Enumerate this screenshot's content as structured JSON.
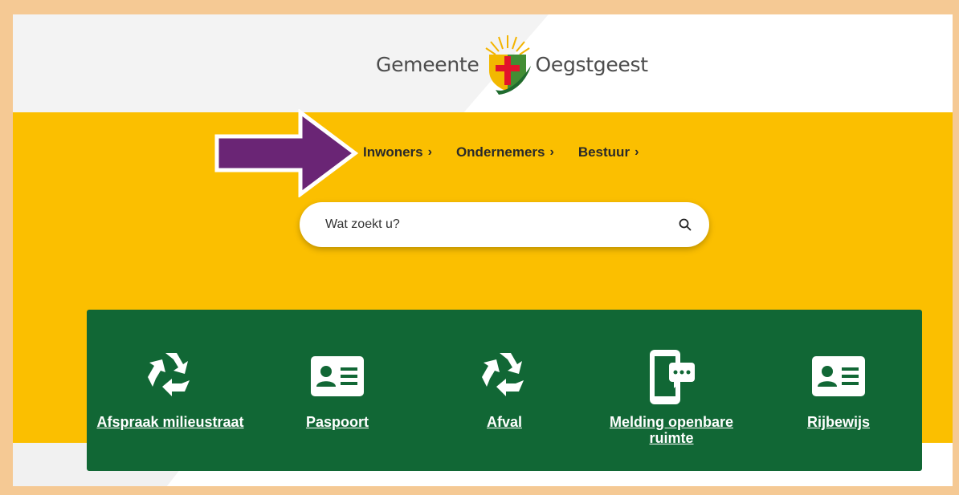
{
  "header": {
    "logo_left": "Gemeente",
    "logo_right": "Oegstgeest"
  },
  "nav": {
    "items": [
      {
        "label": "Inwoners",
        "chevron": "›"
      },
      {
        "label": "Ondernemers",
        "chevron": "›"
      },
      {
        "label": "Bestuur",
        "chevron": "›"
      }
    ]
  },
  "search": {
    "placeholder": "Wat zoekt u?",
    "icon": "search-icon"
  },
  "tiles": [
    {
      "label": "Afspraak milieustraat",
      "icon": "recycle-icon"
    },
    {
      "label": "Paspoort",
      "icon": "id-card-icon"
    },
    {
      "label": "Afval",
      "icon": "recycle-icon"
    },
    {
      "label": "Melding openbare ruimte",
      "icon": "phone-message-icon"
    },
    {
      "label": "Rijbewijs",
      "icon": "id-card-icon"
    }
  ],
  "colors": {
    "hero": "#fbbf00",
    "tiles_bg": "#116735",
    "arrow": "#6a2575",
    "frame": "#f5c994"
  }
}
